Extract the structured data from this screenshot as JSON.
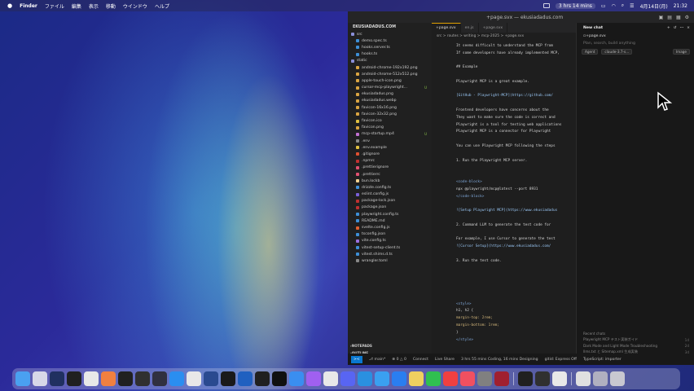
{
  "menubar": {
    "app_name": "Finder",
    "items": [
      "ファイル",
      "編集",
      "表示",
      "移動",
      "ウインドウ",
      "ヘルプ"
    ],
    "timer": "3 hrs 14 mins",
    "date": "4月14日(月)",
    "time": "21:32"
  },
  "window": {
    "title": "+page.svx — ekusiadadus.com"
  },
  "explorer": {
    "project": "EKUSIADADUS.COM",
    "items": [
      {
        "name": "src",
        "type": "folder",
        "color": "#8a8fd8"
      },
      {
        "name": "demo.spec.ts",
        "type": "file",
        "color": "#3d8fd6"
      },
      {
        "name": "hooks.server.ts",
        "type": "file",
        "color": "#3d8fd6"
      },
      {
        "name": "hooks.ts",
        "type": "file",
        "color": "#3d8fd6"
      },
      {
        "name": "static",
        "type": "folder",
        "color": "#8a8fd8"
      },
      {
        "name": "android-chrome-192x192.png",
        "type": "file",
        "color": "#d9a441"
      },
      {
        "name": "android-chrome-512x512.png",
        "type": "file",
        "color": "#d9a441"
      },
      {
        "name": "apple-touch-icon.png",
        "type": "file",
        "color": "#d9a441"
      },
      {
        "name": "cursor-mcp-playwright...",
        "type": "file",
        "color": "#d9a441",
        "badge": "U"
      },
      {
        "name": "ekusiadadus.png",
        "type": "file",
        "color": "#d9a441"
      },
      {
        "name": "ekusiadadus.webp",
        "type": "file",
        "color": "#d9a441"
      },
      {
        "name": "favicon-16x16.png",
        "type": "file",
        "color": "#d9a441"
      },
      {
        "name": "favicon-32x32.png",
        "type": "file",
        "color": "#d9a441"
      },
      {
        "name": "favicon.ico",
        "type": "file",
        "color": "#e0c040"
      },
      {
        "name": "favicon.png",
        "type": "file",
        "color": "#d9a441"
      },
      {
        "name": "mcp-startup.mp4",
        "type": "file",
        "color": "#c070d0",
        "badge": "U"
      },
      {
        "name": ".env",
        "type": "file",
        "color": "#888"
      },
      {
        "name": ".env.example",
        "type": "file",
        "color": "#e0c040"
      },
      {
        "name": ".gitignore",
        "type": "file",
        "color": "#e05030"
      },
      {
        "name": ".npmrc",
        "type": "file",
        "color": "#c03030"
      },
      {
        "name": ".prettierignore",
        "type": "file",
        "color": "#e05070"
      },
      {
        "name": ".prettierrc",
        "type": "file",
        "color": "#e05070"
      },
      {
        "name": "bun.lockb",
        "type": "file",
        "color": "#f0d090"
      },
      {
        "name": "drizzle.config.ts",
        "type": "file",
        "color": "#3d8fd6"
      },
      {
        "name": "eslint.config.js",
        "type": "file",
        "color": "#7a5fd6"
      },
      {
        "name": "package-lock.json",
        "type": "file",
        "color": "#c03030"
      },
      {
        "name": "package.json",
        "type": "file",
        "color": "#c03030"
      },
      {
        "name": "playwright.config.ts",
        "type": "file",
        "color": "#3d8fd6"
      },
      {
        "name": "README.md",
        "type": "file",
        "color": "#3d8fd6"
      },
      {
        "name": "svelte.config.js",
        "type": "file",
        "color": "#e06030"
      },
      {
        "name": "tsconfig.json",
        "type": "file",
        "color": "#3d8fd6"
      },
      {
        "name": "vite.config.ts",
        "type": "file",
        "color": "#9a70e0"
      },
      {
        "name": "vitest-setup-client.ts",
        "type": "file",
        "color": "#3d8fd6"
      },
      {
        "name": "vitest.shims.d.ts",
        "type": "file",
        "color": "#3d8fd6"
      },
      {
        "name": "wrangler.toml",
        "type": "file",
        "color": "#888"
      }
    ],
    "sections": [
      "NOTEPADS",
      "OUTLINE",
      "TIMELINE"
    ]
  },
  "editor": {
    "tabs": [
      {
        "label": "+page.svx",
        "active": true
      },
      {
        "label": "en.js",
        "active": false
      },
      {
        "label": "+page.svx",
        "active": false
      }
    ],
    "breadcrumb": "src > routes > writing > mcp-2025 > +page.svx",
    "lines": [
      {
        "n": "",
        "text": "It seems difficult to understand the MCP from",
        "cls": ""
      },
      {
        "n": "",
        "text": "If some developers have already implemented MCP,",
        "cls": ""
      },
      {
        "n": "",
        "text": "",
        "cls": ""
      },
      {
        "n": "",
        "text": "## Example",
        "cls": ""
      },
      {
        "n": "",
        "text": "",
        "cls": ""
      },
      {
        "n": "",
        "text": "Playwright MCP is a great example.",
        "cls": ""
      },
      {
        "n": "",
        "text": "",
        "cls": ""
      },
      {
        "n": "",
        "text": "[GitHub - Playwright-MCP](https://github.com/",
        "cls": "link"
      },
      {
        "n": "",
        "text": "",
        "cls": ""
      },
      {
        "n": "",
        "text": "Frontend developers have concerns about the",
        "cls": ""
      },
      {
        "n": "",
        "text": "They want to make sure the code is correct and",
        "cls": ""
      },
      {
        "n": "",
        "text": "Playwright is a tool for testing web applications",
        "cls": ""
      },
      {
        "n": "",
        "text": "Playwright MCP is a connector for Playwright",
        "cls": ""
      },
      {
        "n": "",
        "text": "",
        "cls": ""
      },
      {
        "n": "",
        "text": "You can use Playwright MCP following the steps",
        "cls": ""
      },
      {
        "n": "",
        "text": "",
        "cls": ""
      },
      {
        "n": "",
        "text": "1. Run the Playwright MCP server.",
        "cls": ""
      },
      {
        "n": "",
        "text": "",
        "cls": ""
      },
      {
        "n": "",
        "text": "",
        "cls": ""
      },
      {
        "n": "",
        "text": "<code-block>",
        "cls": "tag"
      },
      {
        "n": "",
        "text": "npx @playwright/mcp@latest --port 8931",
        "cls": ""
      },
      {
        "n": "",
        "text": "</code-block>",
        "cls": "tag"
      },
      {
        "n": "",
        "text": "",
        "cls": ""
      },
      {
        "n": "",
        "text": "![Setup Playwright MCP](https://www.ekusiadadus",
        "cls": "link"
      },
      {
        "n": "",
        "text": "",
        "cls": ""
      },
      {
        "n": "",
        "text": "2. Command LLM to generate the test code for",
        "cls": ""
      },
      {
        "n": "",
        "text": "",
        "cls": ""
      },
      {
        "n": "",
        "text": "For example, I use Cursor to generate the test",
        "cls": ""
      },
      {
        "n": "",
        "text": "![Cursor Setup](https://www.ekusiadadus.com/",
        "cls": "link"
      },
      {
        "n": "",
        "text": "",
        "cls": ""
      },
      {
        "n": "",
        "text": "3. Run the test code.",
        "cls": ""
      },
      {
        "n": "",
        "text": "",
        "cls": ""
      },
      {
        "n": "",
        "text": "",
        "cls": ""
      },
      {
        "n": "",
        "text": "",
        "cls": ""
      },
      {
        "n": "",
        "text": "",
        "cls": ""
      },
      {
        "n": "",
        "text": "",
        "cls": ""
      },
      {
        "n": "",
        "text": "<style>",
        "cls": "tag"
      },
      {
        "n": "",
        "text": "  h1, h2 {",
        "cls": ""
      },
      {
        "n": "",
        "text": "    margin-top: 2rem;",
        "cls": "prop"
      },
      {
        "n": "",
        "text": "    margin-bottom: 1rem;",
        "cls": "prop"
      },
      {
        "n": "",
        "text": "  }",
        "cls": ""
      },
      {
        "n": "",
        "text": "</style>",
        "cls": "tag"
      }
    ],
    "line_numbers": [
      "",
      "",
      "",
      "",
      "",
      "",
      "",
      "",
      "",
      "",
      "",
      "",
      "",
      "",
      "",
      "",
      "",
      "",
      "",
      "",
      "",
      "",
      "",
      "",
      "",
      "",
      "",
      "",
      "",
      "",
      "",
      "",
      "",
      "",
      "",
      "",
      "",
      "",
      "",
      "",
      "",
      ""
    ]
  },
  "chat": {
    "title": "New chat",
    "file_ref": "+page.svx",
    "placeholder": "Plan, search, build anything",
    "agent_label": "Agent",
    "model_label": "claude-3.7-s...",
    "image_label": "Image",
    "recent_header": "Recent chats",
    "recent": [
      {
        "title": "Playwright MCP テスト実装ガイド",
        "age": "1d"
      },
      {
        "title": "Dark Mode and Light Mode Troubleshooting",
        "age": "2d"
      },
      {
        "title": "llms.txt と Sitemap.xml 生成実装",
        "age": "3d"
      }
    ]
  },
  "statusbar": {
    "branch": "main*",
    "errors": "0 △ 0",
    "connect": "Connect",
    "live_share": "Live Share",
    "time_tracker": "3 hrs 55 mins Coding, 16 mins Designing",
    "github": "gitid: Express Off",
    "ts": "TypeScript: importer",
    "accent_color": "#0a78d0"
  },
  "dock": {
    "apps": [
      {
        "name": "finder",
        "color": "#4aa0f0"
      },
      {
        "name": "launchpad",
        "color": "#d8d8e8"
      },
      {
        "name": "notes",
        "color": "#203060"
      },
      {
        "name": "figma",
        "color": "#202020"
      },
      {
        "name": "chrome",
        "color": "#e8e8e8"
      },
      {
        "name": "arc",
        "color": "#f08040"
      },
      {
        "name": "cursor",
        "color": "#202020"
      },
      {
        "name": "terminal-alt",
        "color": "#303030"
      },
      {
        "name": "discord",
        "color": "#303040"
      },
      {
        "name": "app-store",
        "color": "#2a8ef0"
      },
      {
        "name": "photos",
        "color": "#e8e8e8"
      },
      {
        "name": "sequel",
        "color": "#2a4a90"
      },
      {
        "name": "terminal",
        "color": "#1a1a1a"
      },
      {
        "name": "vscode",
        "color": "#2060c0"
      },
      {
        "name": "warp",
        "color": "#202020"
      },
      {
        "name": "iterm",
        "color": "#101010"
      },
      {
        "name": "xcode",
        "color": "#3a8ef0"
      },
      {
        "name": "messenger",
        "color": "#a060f0"
      },
      {
        "name": "slack",
        "color": "#e8e8e8"
      },
      {
        "name": "discord-2",
        "color": "#5865f2"
      },
      {
        "name": "docker",
        "color": "#2a90e0"
      },
      {
        "name": "safari",
        "color": "#3aa0f0"
      },
      {
        "name": "app-store-2",
        "color": "#2a7ef0"
      },
      {
        "name": "notes-2",
        "color": "#f0d060"
      },
      {
        "name": "facetime",
        "color": "#30c050"
      },
      {
        "name": "calendar",
        "color": "#f04040"
      },
      {
        "name": "music",
        "color": "#f05060"
      },
      {
        "name": "settings",
        "color": "#808080"
      },
      {
        "name": "screen-capture",
        "color": "#a02030"
      }
    ],
    "recent_apps": [
      {
        "name": "unity",
        "color": "#202020"
      },
      {
        "name": "unity-2",
        "color": "#303030"
      },
      {
        "name": "chrome-2",
        "color": "#e8e8e8"
      }
    ],
    "tray": [
      {
        "name": "document",
        "color": "#e0e0e0"
      },
      {
        "name": "downloads",
        "color": "#b0b0c0"
      },
      {
        "name": "trash",
        "color": "#c8c8d0"
      }
    ]
  }
}
